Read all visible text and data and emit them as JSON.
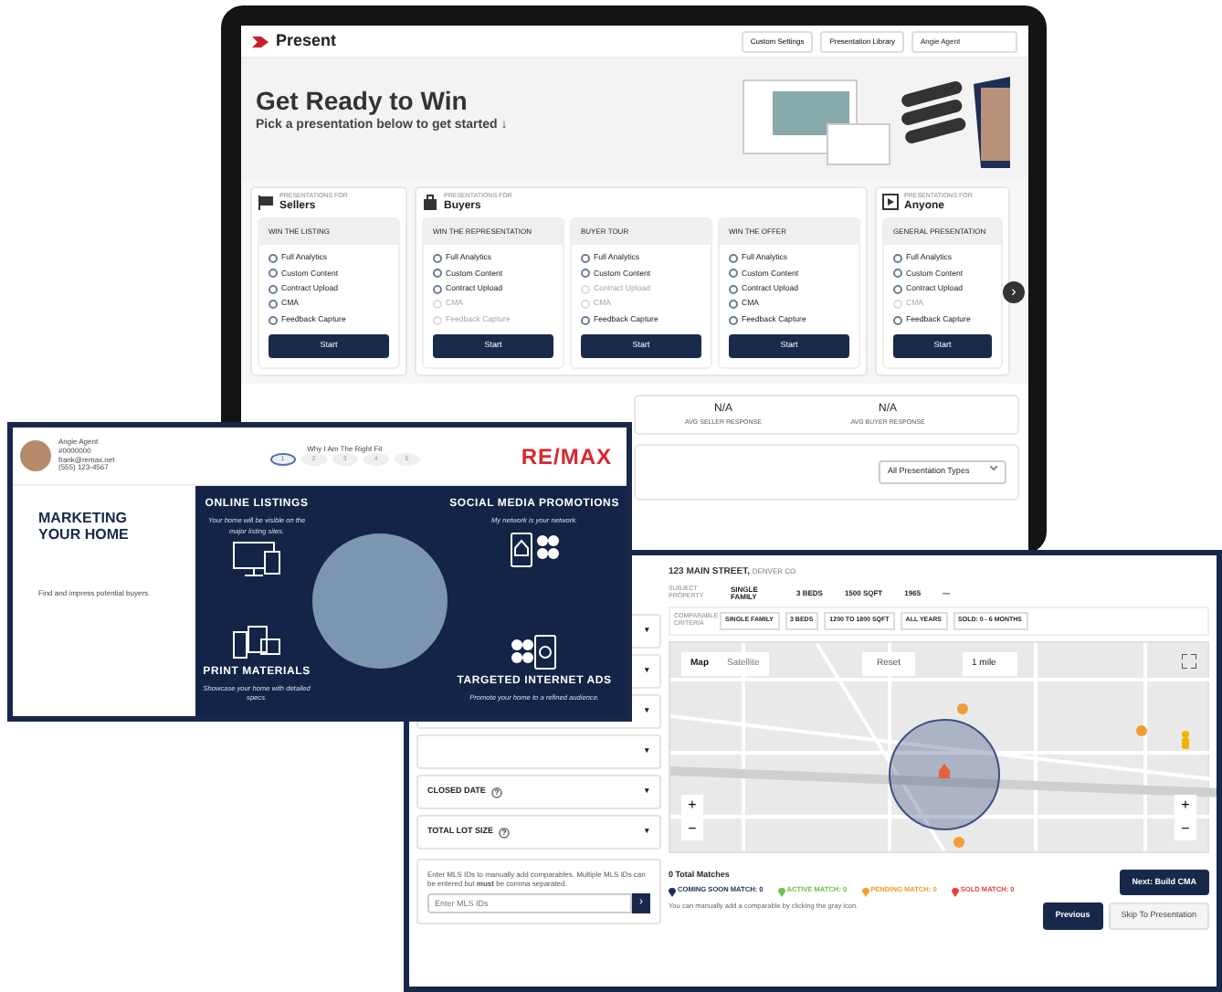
{
  "laptop": {
    "app_name": "Present",
    "header_buttons": [
      "Custom Settings",
      "Presentation Library"
    ],
    "user_select": "Angie Agent",
    "hero": {
      "title": "Get Ready to Win",
      "subtitle": "Pick a presentation below to get started ↓"
    },
    "groups": [
      {
        "kind": "sellers",
        "kicker": "PRESENTATIONS FOR",
        "name": "Sellers",
        "cards": [
          {
            "title": "WIN THE LISTING",
            "button": "Start",
            "features": [
              {
                "label": "Full Analytics",
                "enabled": true
              },
              {
                "label": "Custom Content",
                "enabled": true
              },
              {
                "label": "Contract Upload",
                "enabled": true
              },
              {
                "label": "CMA",
                "enabled": true
              },
              {
                "label": "Feedback Capture",
                "enabled": true
              }
            ]
          }
        ]
      },
      {
        "kind": "buyers",
        "kicker": "PRESENTATIONS FOR",
        "name": "Buyers",
        "cards": [
          {
            "title": "WIN THE REPRESENTATION",
            "button": "Start",
            "features": [
              {
                "label": "Full Analytics",
                "enabled": true
              },
              {
                "label": "Custom Content",
                "enabled": true
              },
              {
                "label": "Contract Upload",
                "enabled": true
              },
              {
                "label": "CMA",
                "enabled": false
              },
              {
                "label": "Feedback Capture",
                "enabled": false
              }
            ]
          },
          {
            "title": "BUYER TOUR",
            "button": "Start",
            "features": [
              {
                "label": "Full Analytics",
                "enabled": true
              },
              {
                "label": "Custom Content",
                "enabled": true
              },
              {
                "label": "Contract Upload",
                "enabled": false
              },
              {
                "label": "CMA",
                "enabled": false
              },
              {
                "label": "Feedback Capture",
                "enabled": true
              }
            ]
          },
          {
            "title": "WIN THE OFFER",
            "button": "Start",
            "features": [
              {
                "label": "Full Analytics",
                "enabled": true
              },
              {
                "label": "Custom Content",
                "enabled": true
              },
              {
                "label": "Contract Upload",
                "enabled": true
              },
              {
                "label": "CMA",
                "enabled": true
              },
              {
                "label": "Feedback Capture",
                "enabled": true
              }
            ]
          }
        ]
      },
      {
        "kind": "anyone",
        "kicker": "PRESENTATIONS FOR",
        "name": "Anyone",
        "cards": [
          {
            "title": "GENERAL PRESENTATION",
            "button": "Start",
            "features": [
              {
                "label": "Full Analytics",
                "enabled": true
              },
              {
                "label": "Custom Content",
                "enabled": true
              },
              {
                "label": "Contract Upload",
                "enabled": true
              },
              {
                "label": "CMA",
                "enabled": false
              },
              {
                "label": "Feedback Capture",
                "enabled": true
              }
            ]
          }
        ]
      }
    ],
    "next_arrow": "›",
    "stats": [
      {
        "value": "N/A",
        "label": "AVG SELLER RESPONSE"
      },
      {
        "value": "N/A",
        "label": "AVG BUYER RESPONSE"
      }
    ],
    "filter_select": "All Presentation Types"
  },
  "presentation": {
    "agent": {
      "name": "Angie Agent",
      "lines": [
        "#0000000",
        "frank@remax.net",
        "(555) 123-4567"
      ]
    },
    "step_title": "Why I Am The Right Fit",
    "steps": [
      {
        "label": "1",
        "selected": true
      },
      {
        "label": "2",
        "selected": false
      },
      {
        "label": "3",
        "selected": false
      },
      {
        "label": "4",
        "selected": false
      },
      {
        "label": "5",
        "selected": false
      }
    ],
    "brand": "RE/MAX",
    "section": {
      "title": "MARKETING YOUR HOME",
      "text": "Find and impress potential buyers."
    },
    "features": [
      {
        "kind": "listings",
        "title": "ONLINE LISTINGS",
        "subtitle": "Your home will be visible on the major listing sites."
      },
      {
        "kind": "social",
        "title": "SOCIAL MEDIA PROMOTIONS",
        "subtitle": "My network is your network."
      },
      {
        "kind": "print",
        "title": "PRINT MATERIALS",
        "subtitle": "Showcase your home with detailed specs."
      },
      {
        "kind": "ads",
        "title": "TARGETED INTERNET ADS",
        "subtitle": "Promote your home to a refined audience."
      }
    ]
  },
  "cma": {
    "address": "123 MAIN STREET,",
    "city": "DENVER CO",
    "subject": {
      "label": "SUBJECT PROPERTY",
      "values": [
        "SINGLE FAMILY",
        "3 BEDS",
        "1500 SQFT",
        "1965",
        "—"
      ]
    },
    "criteria": {
      "label": "COMPARABLE CRITERIA",
      "chips": [
        "SINGLE FAMILY",
        "3 BEDS",
        "1200 TO 1800 SQFT",
        "ALL YEARS",
        "SOLD: 0 - 6 MONTHS"
      ]
    },
    "filters": [
      {
        "caret": "▾"
      },
      {
        "caret": "▾"
      },
      {
        "caret": "▾"
      },
      {
        "caret": "▾"
      },
      {
        "caret": "▾",
        "label": "CLOSED DATE",
        "help": "?"
      },
      {
        "caret": "▾",
        "label": "TOTAL LOT SIZE",
        "help": "?"
      }
    ],
    "mls": {
      "text": "Enter MLS IDs to manually add comparables. Multiple MLS IDs can be entered but **must** be comma separated.",
      "placeholder": "Enter MLS IDs",
      "go": "›"
    },
    "map": {
      "tabs": [
        {
          "label": "Map",
          "selected": true
        },
        {
          "label": "Satellite",
          "selected": false
        }
      ],
      "reset": "Reset",
      "radius": "1 mile",
      "zoom_controls": [
        {
          "in": "+",
          "out": "−"
        },
        {
          "in": "+",
          "out": "−"
        }
      ]
    },
    "matches": "0 Total Matches",
    "legend": [
      {
        "label": "COMING SOON MATCH: 0",
        "color": "#1c2f5a"
      },
      {
        "label": "ACTIVE MATCH: 0",
        "color": "#6cc04a"
      },
      {
        "label": "PENDING MATCH: 0",
        "color": "#f39c33"
      },
      {
        "label": "SOLD MATCH: 0",
        "color": "#e8413c"
      }
    ],
    "hint": "You can manually add a comparable by clicking the gray icon.",
    "buttons": [
      {
        "label": "Next: Build CMA",
        "kind": "primary"
      },
      {
        "label": "Previous",
        "kind": "primary"
      },
      {
        "label": "Skip To Presentation",
        "kind": "secondary"
      }
    ]
  }
}
